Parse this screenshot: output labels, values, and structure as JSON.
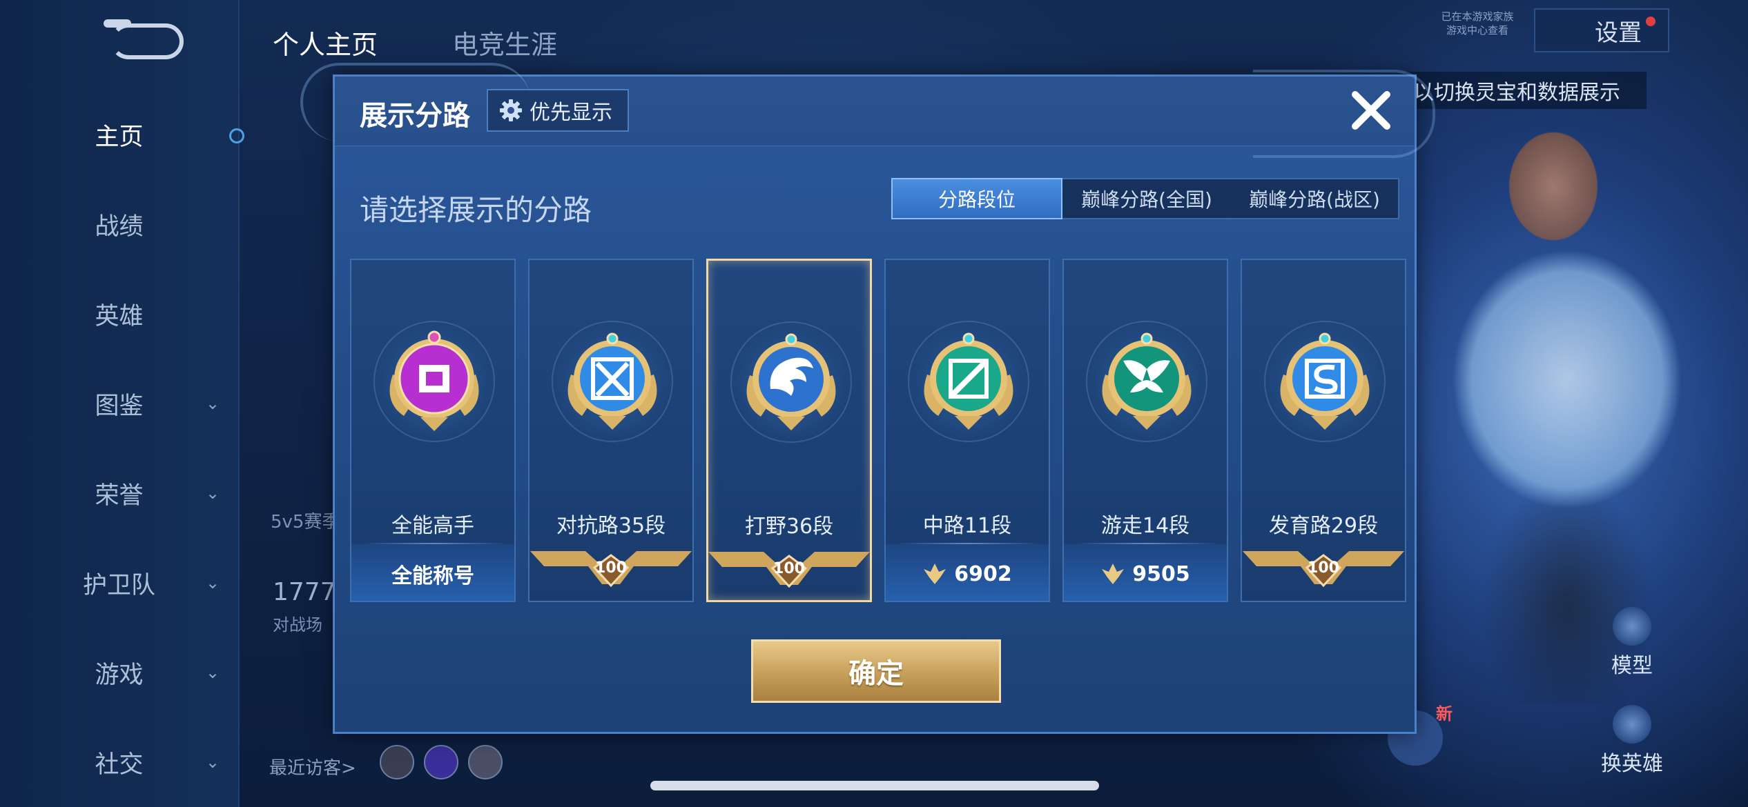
{
  "sidebar": {
    "items": [
      {
        "label": "主页",
        "active": true
      },
      {
        "label": "战绩"
      },
      {
        "label": "英雄"
      },
      {
        "label": "图鉴",
        "expandable": true
      },
      {
        "label": "荣誉",
        "expandable": true
      },
      {
        "label": "护卫队",
        "expandable": true
      },
      {
        "label": "游戏",
        "expandable": true
      },
      {
        "label": "社交",
        "expandable": true
      }
    ]
  },
  "background": {
    "tab_profile": "个人主页",
    "tab_esports": "电竞生涯",
    "settings_label": "设置",
    "game_family_line1": "已在本游戏家族",
    "game_family_line2": "游戏中心查看",
    "hint_banner": "以切换灵宝和数据展示",
    "mode_5v5": "5v5赛季",
    "stat_1777": "1777",
    "battle_label": "对战场",
    "recent_visitors": "最近访客>",
    "new_badge": "新",
    "model_button": "模型",
    "switch_hero_button": "换英雄"
  },
  "dialog": {
    "title": "展示分路",
    "priority_button": "优先显示",
    "subtitle": "请选择展示的分路",
    "segments": [
      "分路段位",
      "巅峰分路(全国)",
      "巅峰分路(战区)"
    ],
    "active_segment": 0,
    "confirm_button": "确定",
    "cards": [
      {
        "name": "全能高手",
        "bottom_text": "全能称号",
        "bottom_type": "title",
        "badge": "all-round-badge-icon",
        "color": "#c03ad8"
      },
      {
        "name": "对抗路35段",
        "bottom_text": "100",
        "bottom_type": "rank",
        "badge": "clash-lane-badge-icon",
        "color": "#3a8ee0"
      },
      {
        "name": "打野36段",
        "bottom_text": "100",
        "bottom_type": "rank",
        "badge": "jungle-badge-icon",
        "color": "#3a78d8",
        "selected": true
      },
      {
        "name": "中路11段",
        "bottom_text": "6902",
        "bottom_type": "peak",
        "badge": "mid-lane-badge-icon",
        "color": "#1fae8c"
      },
      {
        "name": "游走14段",
        "bottom_text": "9505",
        "bottom_type": "peak",
        "badge": "roam-badge-icon",
        "color": "#17a482"
      },
      {
        "name": "发育路29段",
        "bottom_text": "100",
        "bottom_type": "rank",
        "badge": "farm-lane-badge-icon",
        "color": "#3a8ee0"
      }
    ]
  },
  "colors": {
    "accent_gold": "#f5d7a0",
    "accent_blue": "#4a8ee0",
    "dialog_bg": "#2c5a9e"
  }
}
